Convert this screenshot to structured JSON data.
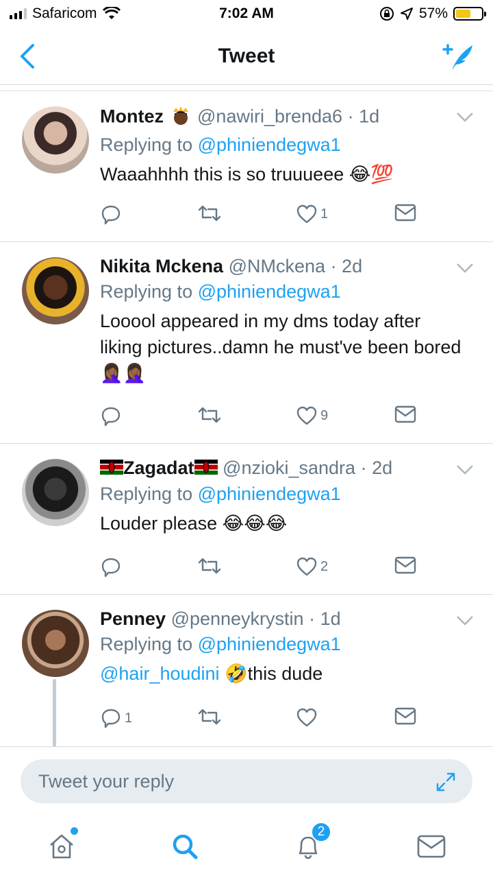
{
  "status_bar": {
    "carrier": "Safaricom",
    "time": "7:02 AM",
    "battery": "57%",
    "battery_level": 0.57
  },
  "navbar": {
    "title": "Tweet"
  },
  "tweets": [
    {
      "name": "Montez",
      "handle": "@nawiri_brenda6",
      "time": "· 1d",
      "replying_prefix": "Replying to",
      "replying_to": "@phiniendegwa1",
      "text": "Waaahhhh this is so truuueee",
      "emoji_after": "😂💯",
      "replies": "",
      "likes": "1"
    },
    {
      "name": "Nikita Mckena",
      "handle": "@NMckena",
      "time": "· 2d",
      "replying_prefix": "Replying to",
      "replying_to": "@phiniendegwa1",
      "text": "Looool appeared in my dms today after liking pictures..damn he must've been bored",
      "emoji_after": "🤦🏾‍♀️🤦🏾‍♀️",
      "replies": "",
      "likes": "9"
    },
    {
      "name": "Zagadat",
      "name_flags": "🇰🇪",
      "handle": "@nzioki_sandra",
      "time": "· 2d",
      "replying_prefix": "Replying to",
      "replying_to": "@phiniendegwa1",
      "text": "Louder please",
      "emoji_after": "😂😂😂",
      "replies": "",
      "likes": "2"
    },
    {
      "name": "Penney",
      "handle": "@penneykrystin",
      "time": "· 1d",
      "replying_prefix": "Replying to",
      "replying_to": "@phiniendegwa1",
      "text_mention": "@hair_houdini",
      "text_emoji": "🤣",
      "text": "this dude",
      "replies": "1",
      "likes": ""
    }
  ],
  "reply_bar": {
    "placeholder": "Tweet your reply"
  },
  "tabbar": {
    "notifications_badge": "2"
  },
  "colors": {
    "accent": "#1da1f2",
    "secondary_text": "#657786",
    "divider": "#d8dde1"
  }
}
